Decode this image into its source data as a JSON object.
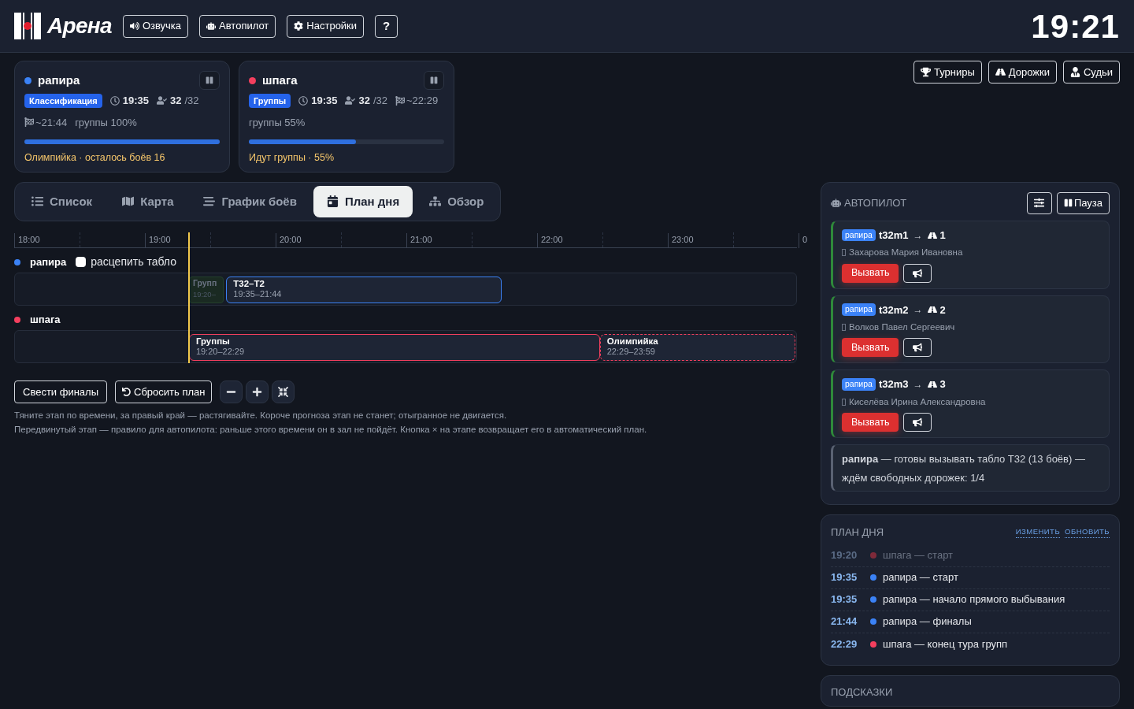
{
  "header": {
    "logo": "Арена",
    "buttons": [
      {
        "kind": "voice",
        "label": "Озвучка"
      },
      {
        "kind": "robot",
        "label": "Автопилот"
      },
      {
        "kind": "gear",
        "label": "Настройки"
      },
      {
        "kind": "help",
        "label": "?"
      }
    ],
    "clock": "19:21"
  },
  "weapons": [
    {
      "name": "рапира",
      "color": "#3b82f6",
      "stage": "Классификация",
      "start": "19:35",
      "fencers": "32",
      "total": "/32",
      "finish": "~21:44",
      "extra": "группы 100%",
      "level": 1,
      "note": "Олимпийка · осталось боёв 16"
    },
    {
      "name": "шпага",
      "color": "#f43f5e",
      "stage": "Группы",
      "start": "19:35",
      "fencers": "32",
      "total": "/32",
      "finish": "~22:29",
      "extra": "группы 55%",
      "level": 0.55,
      "note": "Идут группы · 55%"
    }
  ],
  "top_buttons": [
    {
      "kind": "trophy",
      "label": "Турниры"
    },
    {
      "kind": "road",
      "label": "Дорожки"
    },
    {
      "kind": "judge",
      "label": "Судьи"
    }
  ],
  "tabs": [
    {
      "kind": "list",
      "label": "Список",
      "selected": false
    },
    {
      "kind": "map",
      "label": "Карта",
      "selected": false
    },
    {
      "kind": "bars",
      "label": "График боёв",
      "selected": false
    },
    {
      "kind": "calendar",
      "label": "План дня",
      "selected": true
    },
    {
      "kind": "tree",
      "label": "Обзор",
      "selected": false
    }
  ],
  "timeline": {
    "hours": [
      "18:00",
      "19:00",
      "20:00",
      "21:00",
      "22:00",
      "23:00",
      "0"
    ],
    "now_line": {
      "level": 0.2222
    },
    "lanes": [
      {
        "name": "рапира",
        "color": "#3b82f6",
        "checkbox": {
          "label": "расцепить табло",
          "checked": false
        },
        "blocks": [
          {
            "kind": "faded",
            "title": "Групп",
            "time": "19:20–"
          },
          {
            "kind": "solid",
            "title": "T32–T2",
            "time": "19:35–21:44",
            "color": "#3b82f6"
          }
        ]
      },
      {
        "name": "шпага",
        "color": "#f43f5e",
        "blocks": [
          {
            "kind": "solid",
            "title": "Группы",
            "time": "19:20–22:29",
            "color": "#f43f5e"
          },
          {
            "kind": "dashed",
            "title": "Олимпийка",
            "time": "22:29–23:59",
            "color": "#f43f5e"
          }
        ]
      }
    ]
  },
  "plan_buttons": [
    {
      "kind": "text",
      "label": "Свести финалы"
    },
    {
      "kind": "undo",
      "label": "Сбросить план"
    },
    {
      "kind": "minus"
    },
    {
      "kind": "plus"
    },
    {
      "kind": "compress"
    }
  ],
  "help_lines": [
    "Тяните этап по времени, за правый край — растягивайте. Короче прогноза этап не станет; отыгранное не двигается.",
    "Передвинутый этап — правило для автопилота: раньше этого времени он в зал не пойдёт. Кнопка × на этапе возвращает его в автоматический план."
  ],
  "autopilot": {
    "title": "АВТОПИЛОТ",
    "pause": "Пауза",
    "calls": [
      {
        "tag": "рапира",
        "match": "t32m1",
        "arrow": "→",
        "lane": "1",
        "referee": "Захарова Мария Ивановна",
        "button": "Вызвать"
      },
      {
        "tag": "рапира",
        "match": "t32m2",
        "arrow": "→",
        "lane": "2",
        "referee": "Волков Павел Сергеевич",
        "button": "Вызвать"
      },
      {
        "tag": "рапира",
        "match": "t32m3",
        "arrow": "→",
        "lane": "3",
        "referee": "Киселёва Ирина Александровна",
        "button": "Вызвать"
      }
    ],
    "status": "**рапира** — готовы вызывать табло T32 (13 боёв) — ждём свободных дорожек: 1/4"
  },
  "day_plan": {
    "title": "ПЛАН ДНЯ",
    "links": [
      "ИЗМЕНИТЬ",
      "ОБНОВИТЬ"
    ],
    "items": [
      {
        "time": "19:20",
        "text": "шпага — старт",
        "color": "#7f2a3a",
        "past": true
      },
      {
        "time": "19:35",
        "text": "рапира — старт",
        "color": "#3b82f6",
        "past": false
      },
      {
        "time": "19:35",
        "text": "рапира — начало прямого выбывания",
        "color": "#3b82f6",
        "past": false
      },
      {
        "time": "21:44",
        "text": "рапира — финалы",
        "color": "#3b82f6",
        "past": false
      },
      {
        "time": "22:29",
        "text": "шпага — конец тура групп",
        "color": "#f43f5e",
        "past": false
      }
    ]
  },
  "hints": {
    "title": "ПОДСКАЗКИ"
  }
}
